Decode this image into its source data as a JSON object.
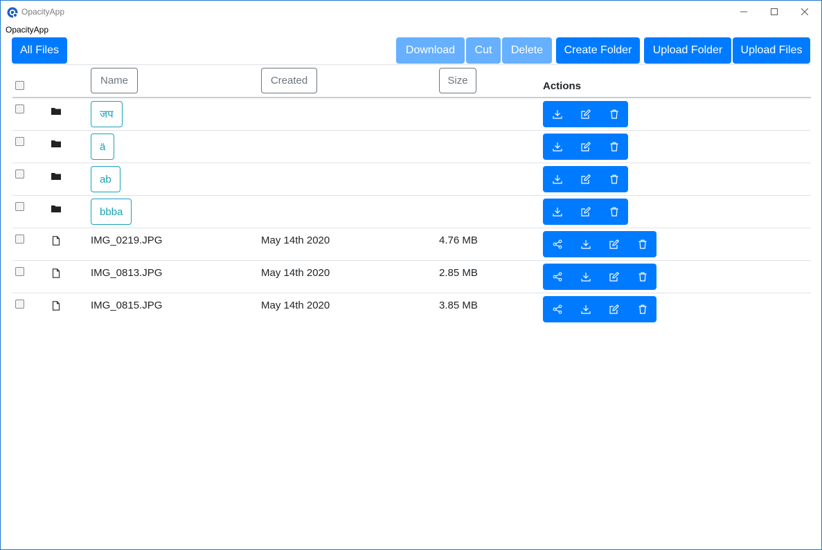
{
  "window": {
    "title": "OpacityApp"
  },
  "menu": {
    "label": "OpacityApp"
  },
  "toolbar": {
    "all_files": "All Files",
    "download": "Download",
    "cut": "Cut",
    "delete": "Delete",
    "create_folder": "Create Folder",
    "upload_folder": "Upload Folder",
    "upload_files": "Upload Files"
  },
  "table": {
    "headers": {
      "name": "Name",
      "created": "Created",
      "size": "Size",
      "actions": "Actions"
    },
    "folders": [
      {
        "name": "जप"
      },
      {
        "name": "ä"
      },
      {
        "name": "ab"
      },
      {
        "name": "bbba"
      }
    ],
    "files": [
      {
        "name": "IMG_0219.JPG",
        "created": "May 14th 2020",
        "size": "4.76 MB"
      },
      {
        "name": "IMG_0813.JPG",
        "created": "May 14th 2020",
        "size": "2.85 MB"
      },
      {
        "name": "IMG_0815.JPG",
        "created": "May 14th 2020",
        "size": "3.85 MB"
      }
    ]
  },
  "colors": {
    "primary": "#007bff",
    "primary_disabled": "#66b0ff",
    "folder_link": "#17a2b8",
    "window_border": "#1979ca"
  }
}
